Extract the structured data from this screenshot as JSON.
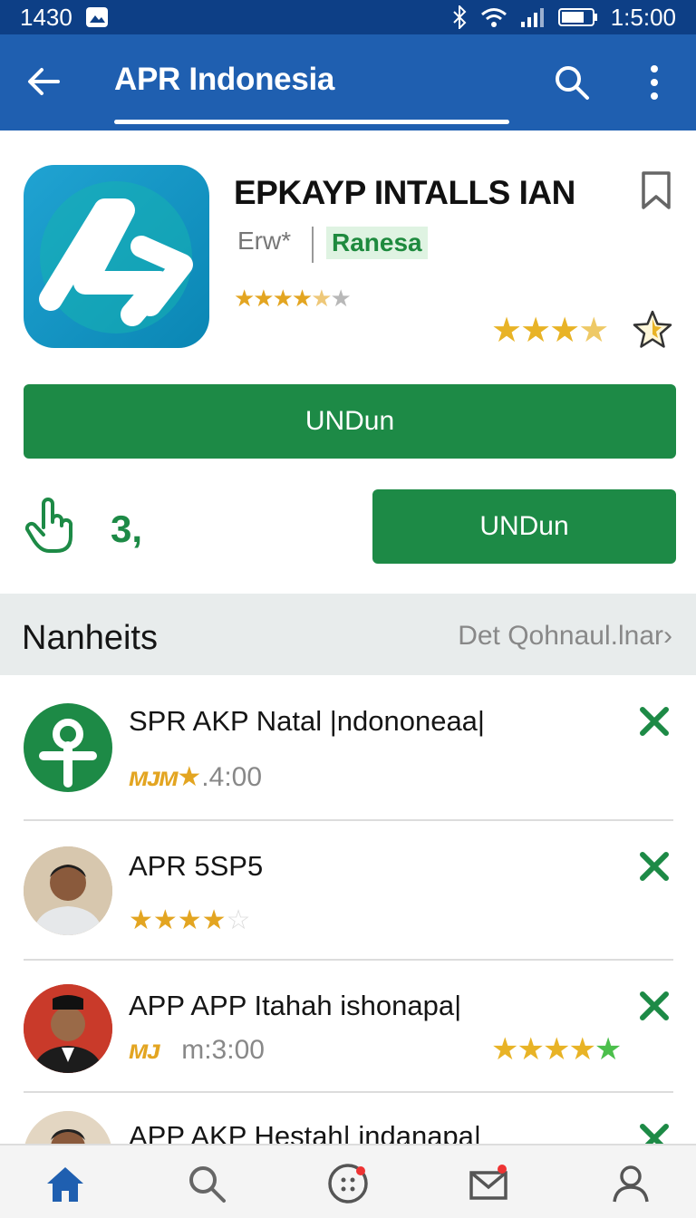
{
  "status": {
    "left_time": "1430",
    "right_time": "1:5:00"
  },
  "appbar": {
    "title": "APR Indonesia"
  },
  "app": {
    "name": "EPKAYP INTALLS IAN",
    "developer": "Erw*",
    "category": "Ranesa",
    "rating_small": 4.5,
    "rating_big": 4
  },
  "buttons": {
    "primary_label": "UNDun",
    "secondary_label": "UNDun"
  },
  "likes": {
    "count": "3,"
  },
  "section": {
    "title": "Nanheits",
    "link": "Det Qohnaul.lnar›"
  },
  "list": [
    {
      "name": "SPR AKP Natal |ndononeaa|",
      "tag": "ᴍᴊᴍ",
      "time": ".4:00"
    },
    {
      "name": "APR 5SP5",
      "rating": 4
    },
    {
      "name": "APP APP Itahah ishonapa|",
      "tag": "ᴍᴊ",
      "time": "m:3:00",
      "rating": 5
    },
    {
      "name": "APP AKP Hestah| indanapa|"
    }
  ],
  "colors": {
    "primary": "#1f5fb0",
    "green": "#1d8a46",
    "star": "#e8b326"
  },
  "icons": [
    "back-arrow-icon",
    "search-icon",
    "more-vert-icon",
    "bookmark-icon",
    "star-outline-icon",
    "hand-pointer-icon",
    "close-icon",
    "home-icon",
    "apps-icon",
    "mail-icon",
    "profile-icon"
  ]
}
